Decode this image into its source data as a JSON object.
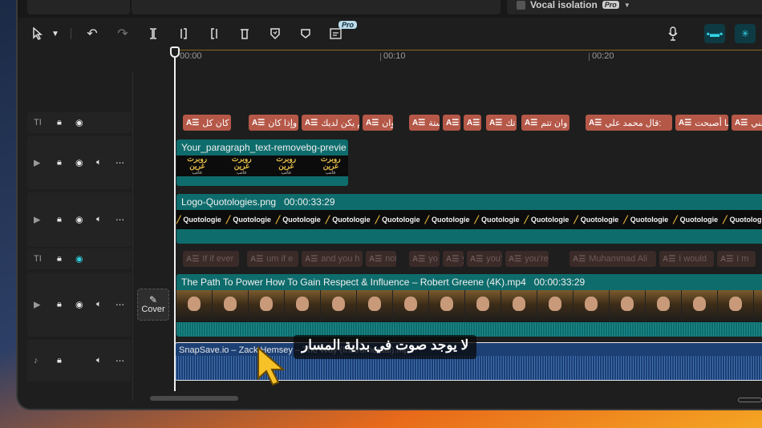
{
  "topbar": {
    "vocal_isolation_label": "Vocal isolation",
    "pro_label": "Pro"
  },
  "toolbar": {
    "pro_badge": "Pro",
    "tools": [
      {
        "name": "select-tool",
        "icon": "cursor-arrow-icon"
      },
      {
        "name": "undo",
        "icon": "undo-icon"
      },
      {
        "name": "redo",
        "icon": "redo-icon"
      },
      {
        "name": "split",
        "icon": "split-icon"
      },
      {
        "name": "split-left",
        "icon": "trim-left-icon"
      },
      {
        "name": "split-right",
        "icon": "trim-right-icon"
      },
      {
        "name": "delete",
        "icon": "delete-icon"
      },
      {
        "name": "mark",
        "icon": "shield-mark-icon"
      },
      {
        "name": "keyframe",
        "icon": "shield-icon"
      },
      {
        "name": "auto-caption",
        "icon": "caption-icon"
      }
    ]
  },
  "ruler": {
    "labels": [
      "00:00",
      "00:10",
      "00:20"
    ]
  },
  "tracks": {
    "text_track_1": {
      "clips": [
        "إذا كان كل",
        "وإذا كان",
        "ولم يكن لديك",
        "وان",
        "ستة",
        "",
        "",
        "وان تك",
        "وان تتم",
        "قال محمد علي:",
        "لما أصبحت",
        "أعني",
        "بي"
      ]
    },
    "overlay_track": {
      "caption": "Your_paragraph_text-removebg-previe",
      "items": [
        "روبرت غرين",
        "روبرت غرين",
        "روبرت غرين",
        "روبرت غرين"
      ],
      "sub": "غاتب"
    },
    "logo_track": {
      "caption": "Logo-Quotologies.png",
      "duration": "00:00:33:29",
      "item": "Quotologie"
    },
    "text_track_2": {
      "clips": [
        "If if ever",
        "um if e",
        "and you h",
        "not",
        "yo",
        "y",
        "you'",
        "you're",
        "Muhammad Ali",
        "I would",
        "I m"
      ]
    },
    "video_track": {
      "caption": "The Path To Power How To Gain Respect & Influence – Robert Greene (4K).mp4",
      "duration": "00:00:33:29"
    },
    "audio_track": {
      "caption": "SnapSave.io – Zack Hemsey – The Way (Instrumental).mp3"
    }
  },
  "cover_label": "Cover",
  "overlay_subtitle": "لا يوجد صوت في بداية المسار"
}
